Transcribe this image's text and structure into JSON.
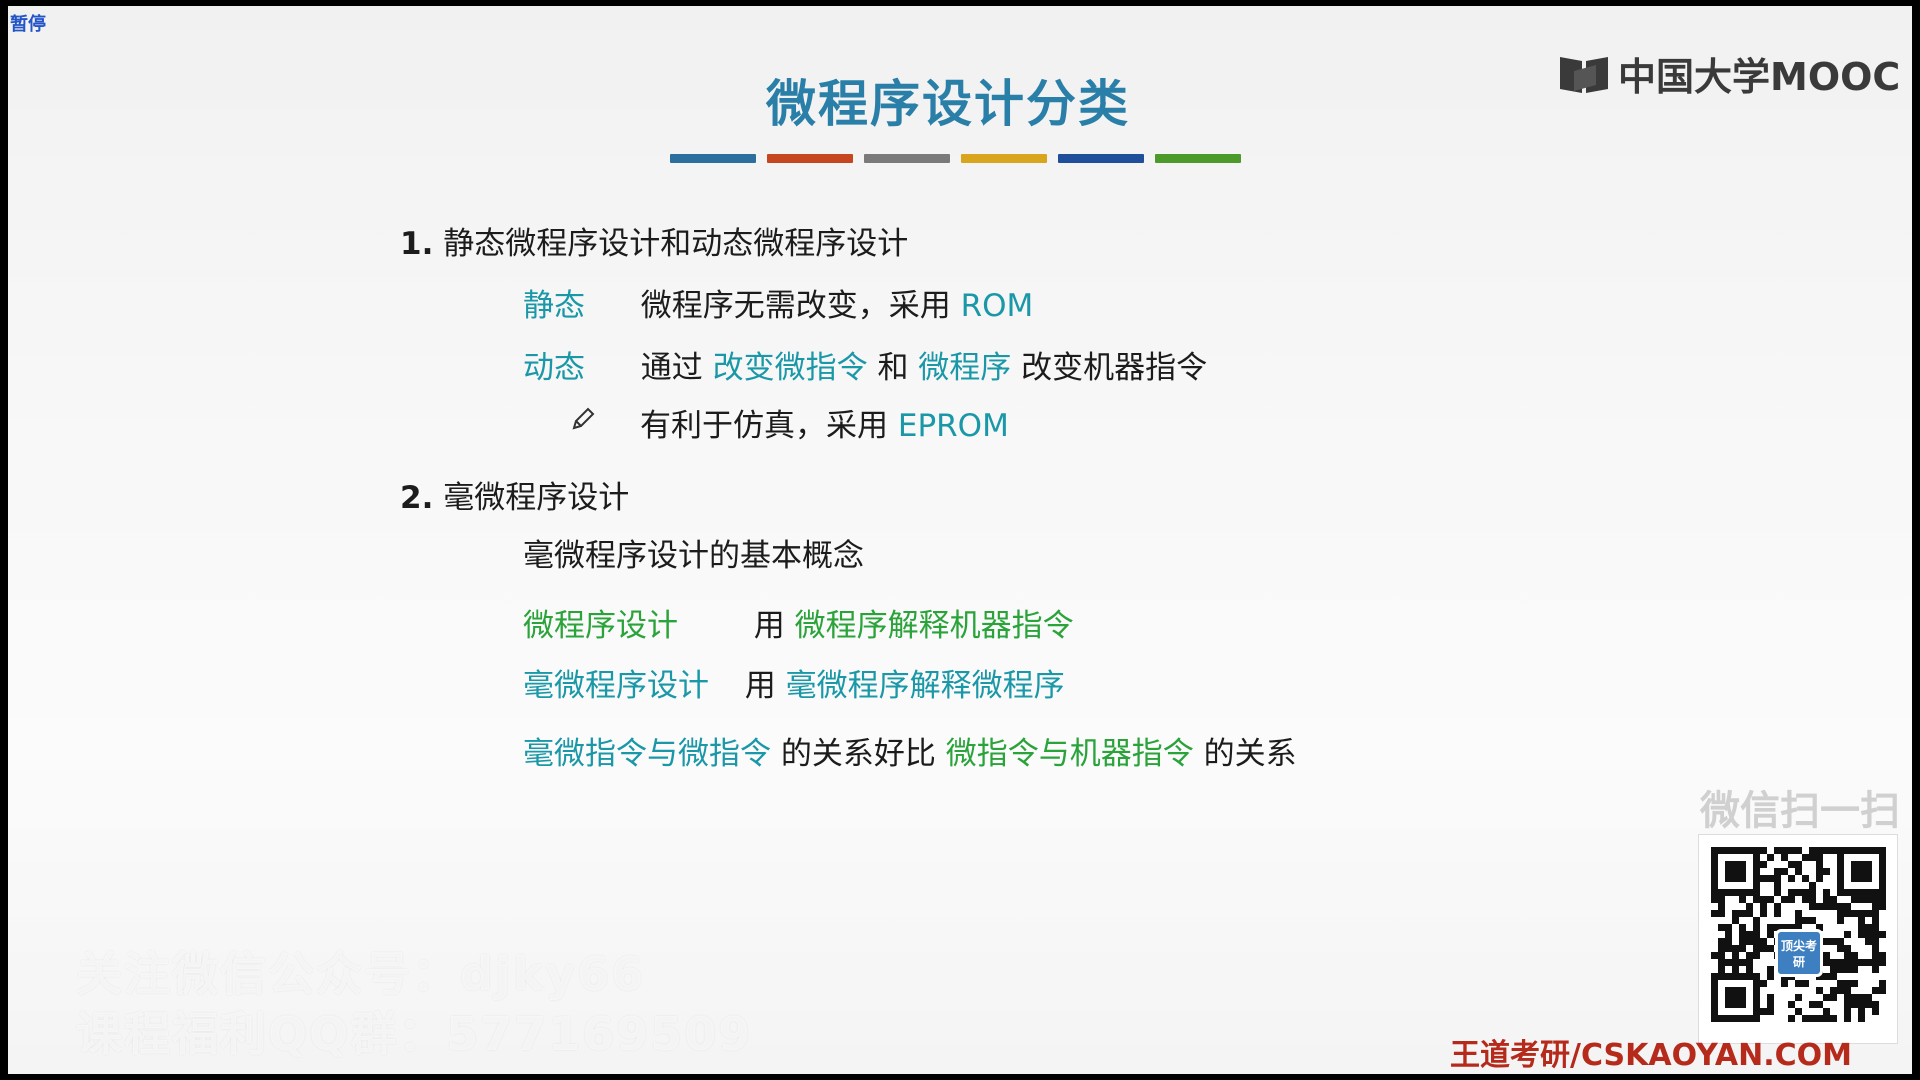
{
  "player": {
    "status_label": "暂停"
  },
  "slide": {
    "title": "微程序设计分类",
    "title_bar_colors": [
      "#2c6e9e",
      "#c6471f",
      "#7a7a7a",
      "#d9a51c",
      "#1f4f9a",
      "#4c9a2a"
    ],
    "logo_text": "中国大学MOOC",
    "section1": {
      "heading_num": "1.",
      "heading": "静态微程序设计和动态微程序设计",
      "static_label": "静态",
      "static_desc": "微程序无需改变，采用",
      "static_tech": "ROM",
      "dynamic_label": "动态",
      "dynamic_via": "通过",
      "dynamic_change1": "改变微指令",
      "dynamic_and": "和",
      "dynamic_change2": "微程序",
      "dynamic_rest": "改变机器指令",
      "note_text": "有利于仿真，采用",
      "note_tech": "EPROM"
    },
    "section2": {
      "heading_num": "2.",
      "heading": "毫微程序设计",
      "concept": "毫微程序设计的基本概念",
      "row1_label": "微程序设计",
      "row1_use": "用",
      "row1_desc": "微程序解释机器指令",
      "row2_label": "毫微程序设计",
      "row2_use": "用",
      "row2_desc": "毫微程序解释微程序",
      "row3_part1": "毫微指令与微指令",
      "row3_part2": "的关系好比",
      "row3_part3": "微指令与机器指令",
      "row3_part4": "的关系"
    }
  },
  "overlay": {
    "watermark_line1": "关注微信公众号：djky66",
    "watermark_line2": "课程福利QQ群：577169509",
    "wechat_scan": "微信扫一扫",
    "qr_center_text": "顶尖考研",
    "brand": "王道考研/CSKAOYAN.COM"
  },
  "colors": {
    "teal": "#1a98a8",
    "green": "#2aa33a",
    "title": "#2a7fa8",
    "brand": "#b52a1a"
  }
}
